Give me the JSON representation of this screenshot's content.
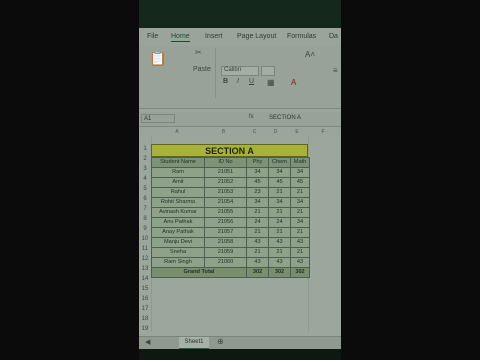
{
  "ribbon": {
    "tabs": [
      "File",
      "Home",
      "Insert",
      "Page Layout",
      "Formulas",
      "Da"
    ],
    "paste_label": "Paste",
    "font_name": "Calibri",
    "bold": "B",
    "italic": "I",
    "underline": "U"
  },
  "formula_bar": {
    "name_box": "A1",
    "content": "SECTION A"
  },
  "grid": {
    "columns": [
      "A",
      "B",
      "C",
      "D",
      "E",
      "F"
    ],
    "rows": [
      "1",
      "2",
      "3",
      "4",
      "5",
      "6",
      "7",
      "8",
      "9",
      "10",
      "11",
      "12",
      "13",
      "14",
      "15",
      "16",
      "17",
      "18",
      "19"
    ]
  },
  "sheet": {
    "title": "SECTION A",
    "headers": [
      "Student Name",
      "ID No",
      "Phy",
      "Chem",
      "Math"
    ],
    "students": [
      [
        "Ram",
        "21051",
        "34",
        "34",
        "34"
      ],
      [
        "Amit",
        "21052",
        "45",
        "45",
        "45"
      ],
      [
        "Rahul",
        "21053",
        "23",
        "21",
        "21"
      ],
      [
        "Rohit Sharma",
        "21054",
        "34",
        "34",
        "34"
      ],
      [
        "Avinash Kumar",
        "21055",
        "21",
        "21",
        "21"
      ],
      [
        "Anu Pathak",
        "21056",
        "24",
        "24",
        "34"
      ],
      [
        "Anay Pathak",
        "21057",
        "21",
        "21",
        "21"
      ],
      [
        "Manju Devi",
        "21058",
        "43",
        "43",
        "43"
      ],
      [
        "Sneha",
        "21059",
        "21",
        "21",
        "21"
      ],
      [
        "Ram Singh",
        "21060",
        "43",
        "43",
        "43"
      ]
    ],
    "total_label": "Grand Total",
    "totals": [
      "302",
      "302",
      "302"
    ]
  },
  "sheet_tabs": [
    "Sheet1"
  ]
}
